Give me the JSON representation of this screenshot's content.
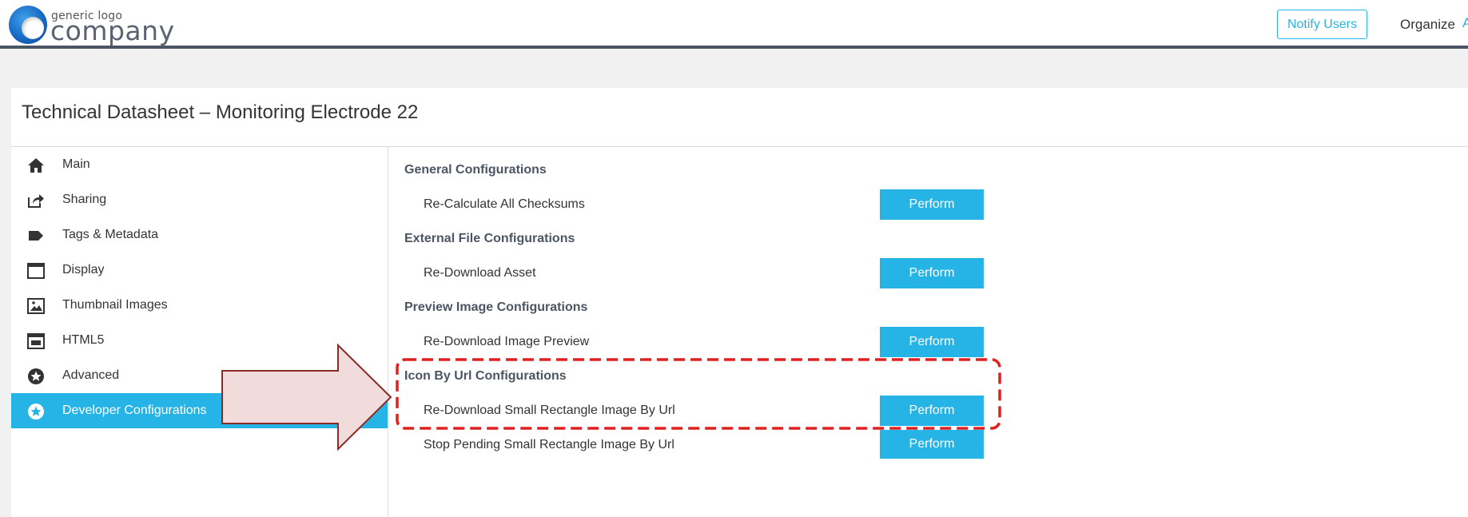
{
  "header": {
    "logo_small": "generic logo",
    "logo_big": "company",
    "notify_button": "Notify Users",
    "nav_organize": "Organize",
    "nav_edge_fragment": "A",
    "accent_color": "#26b4e6",
    "border_color": "#4a5563"
  },
  "page": {
    "title": "Technical Datasheet – Monitoring Electrode 22"
  },
  "sidebar": {
    "items": [
      {
        "label": "Main",
        "icon": "home-icon",
        "active": false
      },
      {
        "label": "Sharing",
        "icon": "share-icon",
        "active": false
      },
      {
        "label": "Tags & Metadata",
        "icon": "tag-icon",
        "active": false
      },
      {
        "label": "Display",
        "icon": "window-icon",
        "active": false
      },
      {
        "label": "Thumbnail Images",
        "icon": "image-icon",
        "active": false
      },
      {
        "label": "HTML5",
        "icon": "html5-icon",
        "active": false
      },
      {
        "label": "Advanced",
        "icon": "star-circle-icon",
        "active": false
      },
      {
        "label": "Developer Configurations",
        "icon": "star-circle-icon",
        "active": true
      }
    ]
  },
  "content": {
    "sections": [
      {
        "title": "General Configurations",
        "rows": [
          {
            "label": "Re-Calculate All Checksums",
            "button": "Perform"
          }
        ]
      },
      {
        "title": "External File Configurations",
        "rows": [
          {
            "label": "Re-Download Asset",
            "button": "Perform"
          }
        ]
      },
      {
        "title": "Preview Image Configurations",
        "rows": [
          {
            "label": "Re-Download Image Preview",
            "button": "Perform"
          }
        ]
      },
      {
        "title": "Icon By Url Configurations",
        "rows": [
          {
            "label": "Re-Download Small Rectangle Image By Url",
            "button": "Perform"
          },
          {
            "label": "Stop Pending Small Rectangle Image By Url",
            "button": "Perform"
          }
        ]
      }
    ]
  },
  "annotation": {
    "arrow_fill": "#f2dcdb",
    "arrow_stroke": "#8b2b26",
    "highlight_color": "#e02020"
  }
}
